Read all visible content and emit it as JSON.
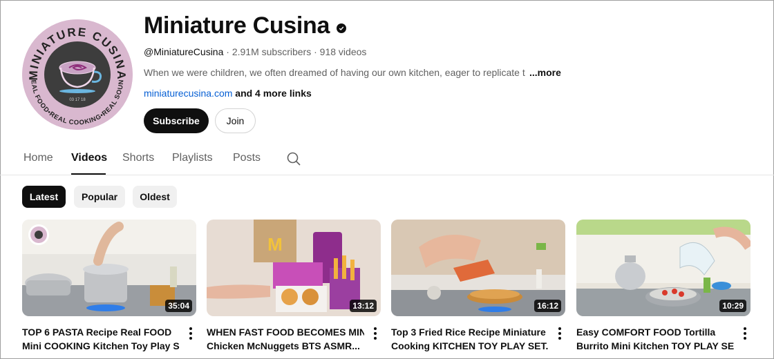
{
  "channel": {
    "name": "Miniature Cusina",
    "handle": "@MiniatureCusina",
    "subscribers": "2.91M subscribers",
    "videos_count": "918 videos",
    "description": "When we were children, we often dreamed of having our own kitchen, eager to replicate t",
    "more_label": "...more",
    "link": "miniaturecusina.com",
    "more_links": "and 4 more links",
    "logo_text_top": "MINIATURE CUSINA",
    "logo_text_bottom": "REAL FOOD•REAL COOKING•REAL SOUND",
    "logo_date": "03 17 18"
  },
  "buttons": {
    "subscribe": "Subscribe",
    "join": "Join"
  },
  "tabs": [
    {
      "label": "Home",
      "active": false
    },
    {
      "label": "Videos",
      "active": true
    },
    {
      "label": "Shorts",
      "active": false
    },
    {
      "label": "Playlists",
      "active": false
    },
    {
      "label": "Posts",
      "active": false
    }
  ],
  "chips": [
    {
      "label": "Latest",
      "active": true
    },
    {
      "label": "Popular",
      "active": false
    },
    {
      "label": "Oldest",
      "active": false
    }
  ],
  "videos": [
    {
      "title_line1": "TOP 6 PASTA Recipe Real FOOD",
      "title_line2": "Mini COOKING Kitchen Toy Play S...",
      "duration": "35:04"
    },
    {
      "title_line1": "WHEN FAST FOOD BECOMES MINI",
      "title_line2": "Chicken McNuggets BTS ASMR...",
      "duration": "13:12"
    },
    {
      "title_line1": "Top 3 Fried Rice Recipe Miniature",
      "title_line2": "Cooking KITCHEN TOY PLAY SET...",
      "duration": "16:12"
    },
    {
      "title_line1": "Easy COMFORT FOOD Tortilla",
      "title_line2": "Burrito Mini Kitchen TOY PLAY SE...",
      "duration": "10:29"
    }
  ],
  "colors": {
    "brand_pink": "#d9b8cf",
    "link_blue": "#065fd4",
    "text_primary": "#0f0f0f",
    "text_secondary": "#606060"
  },
  "icons": {
    "verified": "verified-badge-icon",
    "search": "search-icon",
    "more": "more-vert-icon"
  }
}
